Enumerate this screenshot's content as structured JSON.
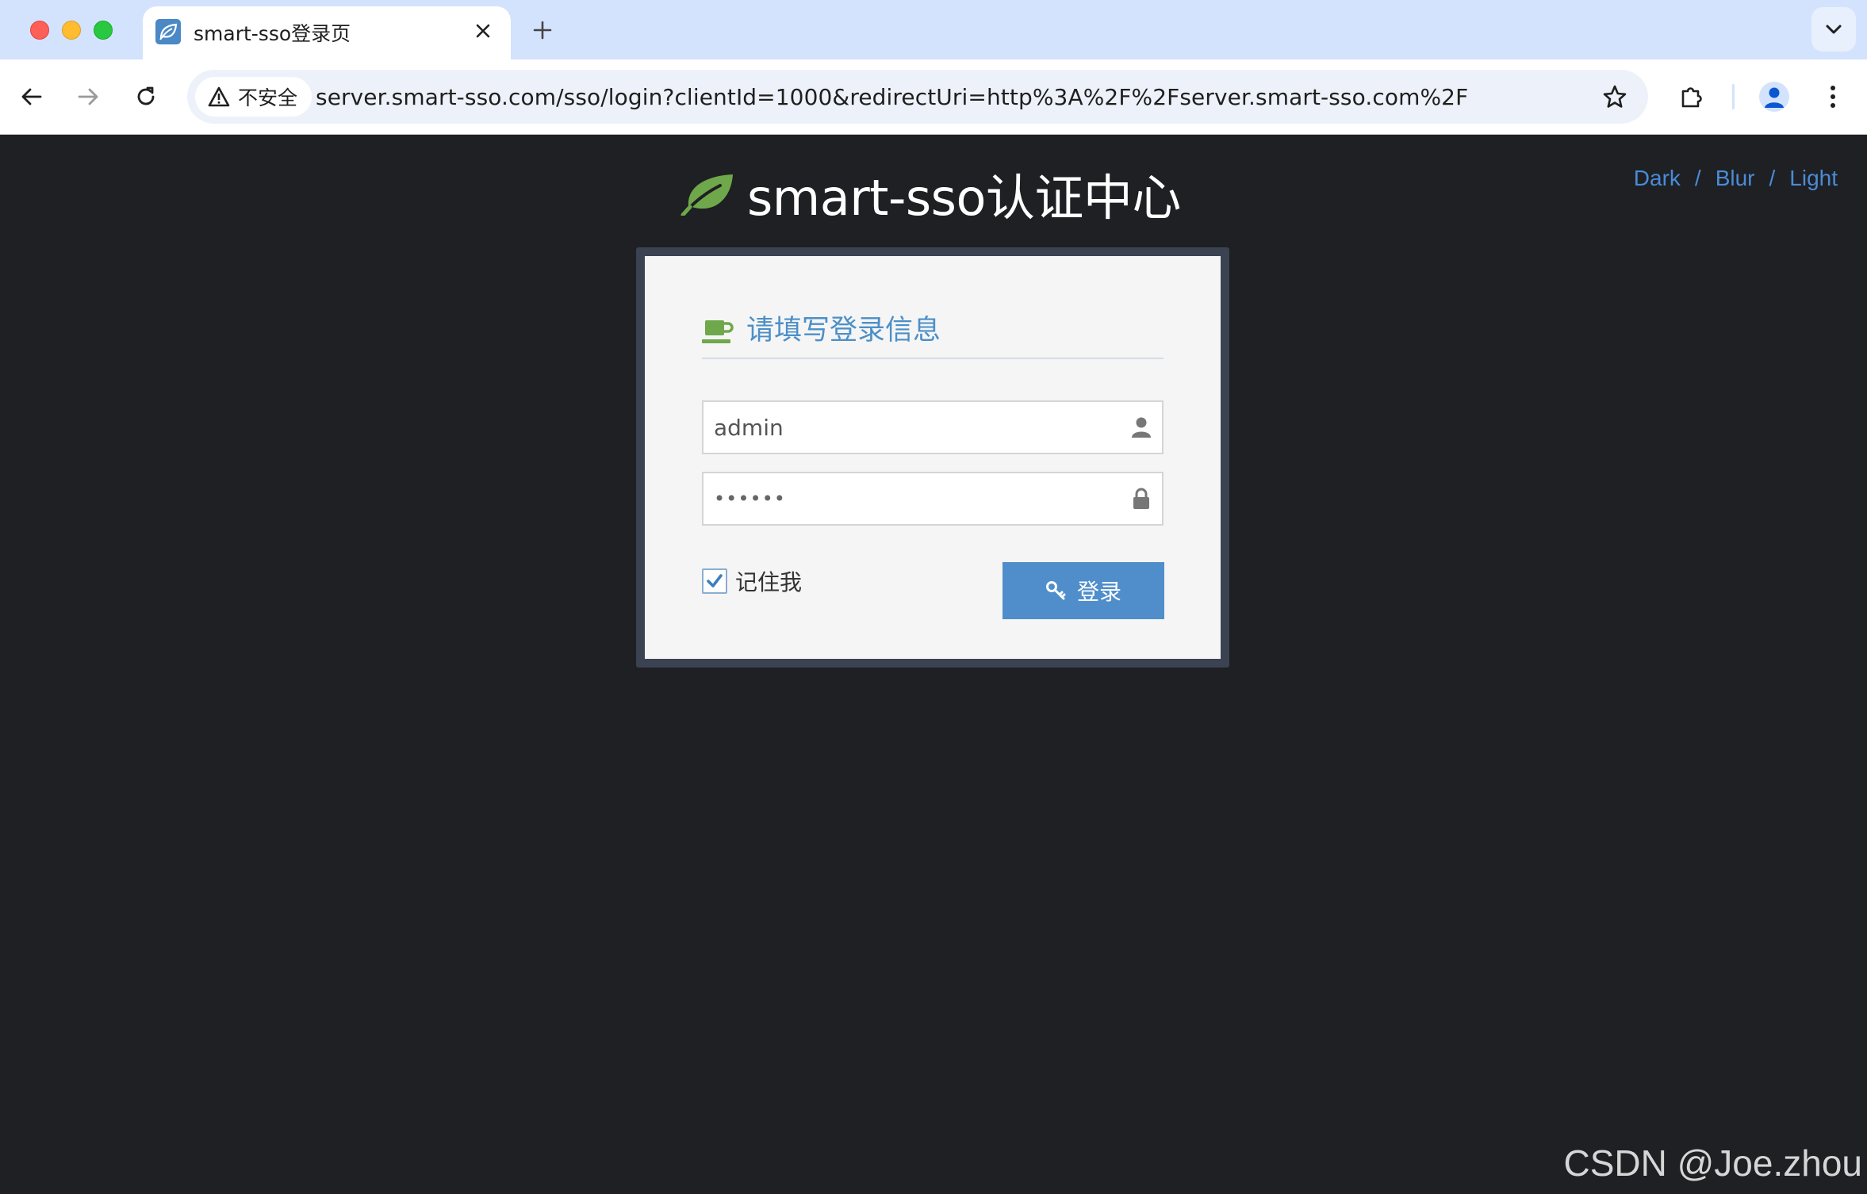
{
  "browser": {
    "tab": {
      "title": "smart-sso登录页",
      "favicon": "leaf-icon"
    },
    "omnibox": {
      "security_label": "不安全",
      "url": "server.smart-sso.com/sso/login?clientId=1000&redirectUri=http%3A%2F%2Fserver.smart-sso.com%2F"
    },
    "icons": {
      "back": "arrow-left-icon",
      "forward": "arrow-right-icon",
      "reload": "reload-icon",
      "bookmark": "star-icon",
      "extensions": "puzzle-icon",
      "profile": "person-icon",
      "menu": "kebab-menu-icon",
      "new_tab": "plus-icon",
      "tab_close": "close-icon",
      "tab_search": "chevron-down-icon"
    }
  },
  "page": {
    "theme_links": [
      "Dark",
      "Blur",
      "Light"
    ],
    "theme_separator": "/",
    "brand_title": "smart-sso认证中心",
    "login": {
      "heading": "请填写登录信息",
      "username": "admin",
      "password_masked": "••••••",
      "remember_label": "记住我",
      "remember_checked": true,
      "submit_label": "登录"
    }
  },
  "watermark": "CSDN @Joe.zhou",
  "colors": {
    "page_bg": "#1e2024",
    "frame_border": "#3b4352",
    "panel_bg": "#f5f5f5",
    "accent_blue": "#4f8ecb",
    "heading_blue": "#4c8fc8",
    "link_blue": "#4b8bd6",
    "brand_green": "#6fa84a"
  }
}
